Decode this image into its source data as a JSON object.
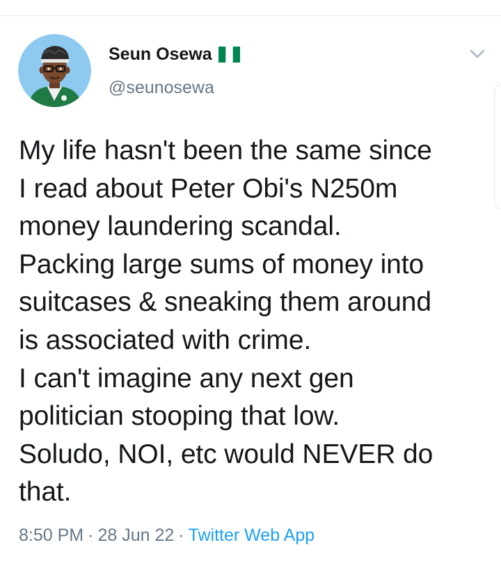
{
  "tweet": {
    "author": {
      "display_name": "Seun Osewa",
      "handle": "@seunosewa",
      "flag_icon": "nigeria-flag-icon",
      "avatar_icon": "cartoon-avatar-icon"
    },
    "text": "My life hasn't been the same since\nI read about Peter Obi's N250m\nmoney laundering scandal.\nPacking large sums of money into\nsuitcases & sneaking them around\nis associated with crime.\nI can't imagine any next gen\npolitician stooping that low.\nSoludo, NOI, etc would NEVER do\nthat.",
    "time": "8:50 PM",
    "date": "28 Jun 22",
    "separator": "·",
    "source": "Twitter Web App",
    "menu_icon": "chevron-down-icon"
  },
  "colors": {
    "text_primary": "#14171a",
    "text_secondary": "#657786",
    "link": "#1da1f2",
    "divider": "#e6ecf0",
    "flag_green": "#008751",
    "avatar_bg": "#8ecaf0"
  }
}
